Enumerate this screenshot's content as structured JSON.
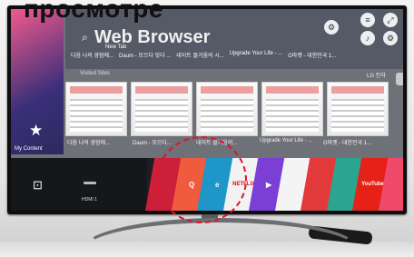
{
  "caption": "просмотре",
  "browser": {
    "title": "Web Browser",
    "new_tab": "New Tab",
    "visited_sites_label": "Visited Sites",
    "site_tabs": [
      "다음 나의 경험에...",
      "Daum - 모으다 잇다 ...",
      "네이트 즐거움의 시...",
      "Upgrade Your Life - ...",
      "G마켓 - 대한민국 1..."
    ],
    "thumbnails": [
      {
        "label": "다음 나의 경험에..."
      },
      {
        "label": "Daum - 모으다..."
      },
      {
        "label": "네이트 즐거움의..."
      },
      {
        "label": "Upgrade Your Life - ..."
      },
      {
        "label": "G마켓 - 대한민국 1..."
      }
    ],
    "lg_label": "LG 전자"
  },
  "sidebar": {
    "my_content": "My Content"
  },
  "launcher": {
    "hdmi_label": "HDMI 1",
    "tiles": [
      {
        "name": "tv-tile",
        "label": "",
        "color": "#cc1f3a"
      },
      {
        "name": "search-tile",
        "label": "Q",
        "color": "#f05a3d"
      },
      {
        "name": "browser-tile",
        "label": "e",
        "color": "#1e96c8"
      },
      {
        "name": "netflix-tile",
        "label": "NETFLIX",
        "color": "#f2f2f2",
        "text": "#e50914"
      },
      {
        "name": "live-tile",
        "label": "▶",
        "color": "#7b3fd6"
      },
      {
        "name": "app-tile-1",
        "label": "",
        "color": "#f4f4f4"
      },
      {
        "name": "app-tile-2",
        "label": "",
        "color": "#e23a3a"
      },
      {
        "name": "app-tile-3",
        "label": "",
        "color": "#2aa58f"
      },
      {
        "name": "youtube-tile",
        "label": "YouTube",
        "color": "#e62117"
      },
      {
        "name": "app-tile-4",
        "label": "",
        "color": "#ef4a6a"
      }
    ]
  },
  "colors": {
    "highlight": "#e0142a",
    "launcher_bg": "#1d1e22"
  }
}
